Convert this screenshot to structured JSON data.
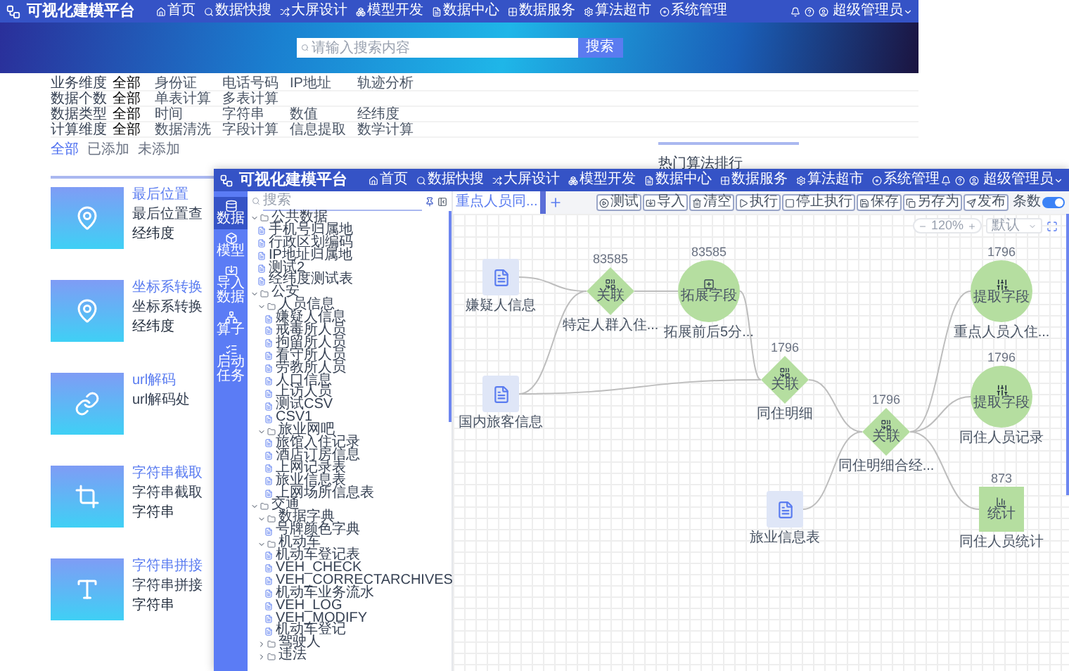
{
  "back_window": {
    "header": {
      "title": "可视化建模平台",
      "nav": [
        {
          "label": "首页"
        },
        {
          "label": "数据快搜"
        },
        {
          "label": "大屏设计"
        },
        {
          "label": "模型开发"
        },
        {
          "label": "数据中心"
        },
        {
          "label": "数据服务"
        },
        {
          "label": "算法超市"
        },
        {
          "label": "系统管理"
        }
      ],
      "user": "超级管理员"
    },
    "banner": {
      "search": {
        "placeholder": "请输入搜索内容"
      },
      "button": "搜索"
    },
    "filters": [
      {
        "label": "业务维度",
        "options": [
          {
            "label": "全部",
            "selected": true
          },
          {
            "label": "身份证",
            "selected": false
          },
          {
            "label": "电话号码",
            "selected": false
          },
          {
            "label": "IP地址",
            "selected": false
          },
          {
            "label": "轨迹分析",
            "selected": false
          }
        ]
      },
      {
        "label": "数据个数",
        "options": [
          {
            "label": "全部",
            "selected": true
          },
          {
            "label": "单表计算",
            "selected": false
          },
          {
            "label": "多表计算",
            "selected": false
          }
        ]
      },
      {
        "label": "数据类型",
        "options": [
          {
            "label": "全部",
            "selected": true
          },
          {
            "label": "时间",
            "selected": false
          },
          {
            "label": "字符串",
            "selected": false
          },
          {
            "label": "数值",
            "selected": false
          },
          {
            "label": "经纬度",
            "selected": false
          }
        ]
      },
      {
        "label": "计算维度",
        "options": [
          {
            "label": "全部",
            "selected": true
          },
          {
            "label": "数据清洗",
            "selected": false
          },
          {
            "label": "字段计算",
            "selected": false
          },
          {
            "label": "信息提取",
            "selected": false
          },
          {
            "label": "数学计算",
            "selected": false
          }
        ]
      }
    ],
    "tabs": [
      {
        "label": "全部",
        "selected": true
      },
      {
        "label": "已添加",
        "selected": false
      },
      {
        "label": "未添加",
        "selected": false
      }
    ],
    "ranking": {
      "title": "热门算法排行"
    },
    "cards": [
      {
        "title": "最后位置",
        "description": "最后位置查",
        "tag": "经纬度"
      },
      {
        "title": "坐标系转换",
        "description": "坐标系转换",
        "tag": "经纬度"
      },
      {
        "title": "url解码",
        "description": "url解码处"
      },
      {
        "title": "字符串截取",
        "description": "字符串截取",
        "tag": "字符串"
      },
      {
        "title": "字符串拼接",
        "description": "字符串拼接",
        "tag": "字符串"
      }
    ]
  },
  "front_window": {
    "header": {
      "title": "可视化建模平台",
      "nav": [
        {
          "label": "首页"
        },
        {
          "label": "数据快搜"
        },
        {
          "label": "大屏设计"
        },
        {
          "label": "模型开发"
        },
        {
          "label": "数据中心"
        },
        {
          "label": "数据服务"
        },
        {
          "label": "算法超市"
        },
        {
          "label": "系统管理"
        }
      ],
      "user": "超级管理员"
    },
    "rail": [
      {
        "label": "数据",
        "selected": true
      },
      {
        "label": "模型",
        "selected": false
      },
      {
        "label": "导入数据",
        "selected": false
      },
      {
        "label": "算子",
        "selected": false
      },
      {
        "label": "启动任务",
        "selected": false
      }
    ],
    "tree": {
      "search": {
        "placeholder": "搜索"
      },
      "items": [
        {
          "label": "公共数据",
          "expanded": true,
          "children": [
            {
              "label": "手机号归属地"
            },
            {
              "label": "行政区划编码"
            },
            {
              "label": "IP地址归属地"
            },
            {
              "label": "测试2"
            },
            {
              "label": "经纬度测试表"
            }
          ]
        },
        {
          "label": "公安",
          "expanded": true,
          "children": [
            {
              "label": "人员信息",
              "expanded": true,
              "children": [
                {
                  "label": "嫌疑人信息"
                },
                {
                  "label": "戒毒所人员"
                },
                {
                  "label": "拘留所人员"
                },
                {
                  "label": "看守所人员"
                },
                {
                  "label": "劳教所人员"
                },
                {
                  "label": "人口信息"
                },
                {
                  "label": "上访人员"
                },
                {
                  "label": "测试CSV"
                },
                {
                  "label": "CSV1"
                }
              ]
            },
            {
              "label": "旅业网吧",
              "expanded": true,
              "children": [
                {
                  "label": "旅馆入住记录"
                },
                {
                  "label": "酒店订房信息"
                },
                {
                  "label": "上网记录表"
                },
                {
                  "label": "旅业信息表"
                },
                {
                  "label": "上网场所信息表"
                }
              ]
            }
          ]
        },
        {
          "label": "交通",
          "expanded": true,
          "children": [
            {
              "label": "数据字典",
              "expanded": true,
              "children": [
                {
                  "label": "号牌颜色字典"
                }
              ]
            },
            {
              "label": "机动车",
              "expanded": true,
              "children": [
                {
                  "label": "机动车登记表"
                },
                {
                  "label": "VEH_CHECK"
                },
                {
                  "label": "VEH_CORRECTARCHIVES"
                },
                {
                  "label": "机动车业务流水"
                },
                {
                  "label": "VEH_LOG"
                },
                {
                  "label": "VEH_MODIFY"
                },
                {
                  "label": "机动车登记"
                }
              ]
            },
            {
              "label": "驾驶人",
              "expanded": false
            },
            {
              "label": "违法",
              "expanded": false
            }
          ]
        }
      ]
    },
    "canvas": {
      "tabs": [
        {
          "label": "重点人员同...",
          "selected": true
        }
      ],
      "toolbar": [
        {
          "label": "测试"
        },
        {
          "label": "导入"
        },
        {
          "label": "清空"
        },
        {
          "label": "执行"
        },
        {
          "label": "停止执行"
        },
        {
          "label": "保存"
        },
        {
          "label": "另存为"
        },
        {
          "label": "发布"
        }
      ],
      "count_toggle": {
        "label": "条数",
        "on": true
      },
      "zoom": "120%",
      "layout": "默认",
      "nodes": [
        {
          "kind": "source",
          "label": "嫌疑人信息"
        },
        {
          "kind": "source",
          "label": "国内旅客信息"
        },
        {
          "kind": "join",
          "label": "特定人群入住...",
          "op": "关联",
          "count": "83585"
        },
        {
          "kind": "expand",
          "label": "拓展前后5分...",
          "op": "拓展字段",
          "count": "83585"
        },
        {
          "kind": "join",
          "label": "同住明细",
          "op": "关联",
          "count": "1796"
        },
        {
          "kind": "source",
          "label": "旅业信息表"
        },
        {
          "kind": "join",
          "label": "同住明细合经...",
          "op": "关联",
          "count": "1796"
        },
        {
          "kind": "extract",
          "label": "重点人员入住...",
          "op": "提取字段",
          "count": "1796"
        },
        {
          "kind": "extract",
          "label": "同住人员记录",
          "op": "提取字段",
          "count": "1796"
        },
        {
          "kind": "stat",
          "label": "同住人员统计",
          "op": "统计",
          "count": "873"
        }
      ]
    }
  }
}
